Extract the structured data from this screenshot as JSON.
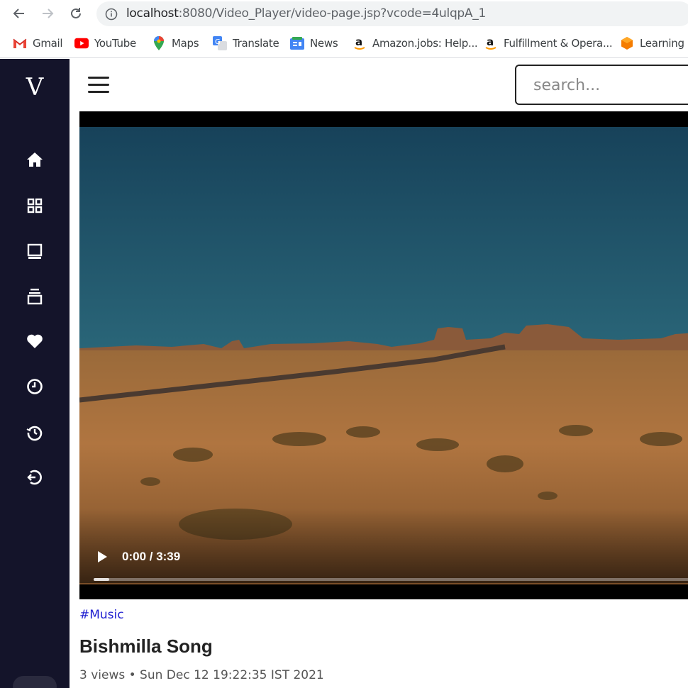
{
  "browser": {
    "url_host": "localhost",
    "url_path": ":8080/Video_Player/video-page.jsp?vcode=4ulqpA_1",
    "bookmarks": [
      {
        "label": "Gmail",
        "icon": "gmail-icon"
      },
      {
        "label": "YouTube",
        "icon": "youtube-icon"
      },
      {
        "label": "Maps",
        "icon": "maps-icon"
      },
      {
        "label": "Translate",
        "icon": "translate-icon"
      },
      {
        "label": "News",
        "icon": "news-icon"
      },
      {
        "label": "Amazon.jobs: Help...",
        "icon": "amazon-icon"
      },
      {
        "label": "Fulfillment & Opera...",
        "icon": "amazon-icon"
      },
      {
        "label": "Learning L",
        "icon": "learning-icon"
      }
    ]
  },
  "sidebar": {
    "logo": "V",
    "items": [
      {
        "name": "home",
        "icon": "home-icon"
      },
      {
        "name": "grid",
        "icon": "grid-icon"
      },
      {
        "name": "book",
        "icon": "book-icon"
      },
      {
        "name": "collection",
        "icon": "collection-icon"
      },
      {
        "name": "liked",
        "icon": "heart-icon"
      },
      {
        "name": "watch-later",
        "icon": "clock-icon"
      },
      {
        "name": "history",
        "icon": "history-icon"
      },
      {
        "name": "logout",
        "icon": "logout-icon"
      }
    ]
  },
  "header": {
    "search_placeholder": "search..."
  },
  "video": {
    "time": "0:00 / 3:39",
    "progress": 0.0
  },
  "details": {
    "hashtag": "#Music",
    "title": "Bishmilla Song",
    "meta": "3 views • Sun Dec 12 19:22:35 IST 2021"
  },
  "colors": {
    "sidebar_bg": "#14142a",
    "hashtag": "#1f1fd0"
  }
}
